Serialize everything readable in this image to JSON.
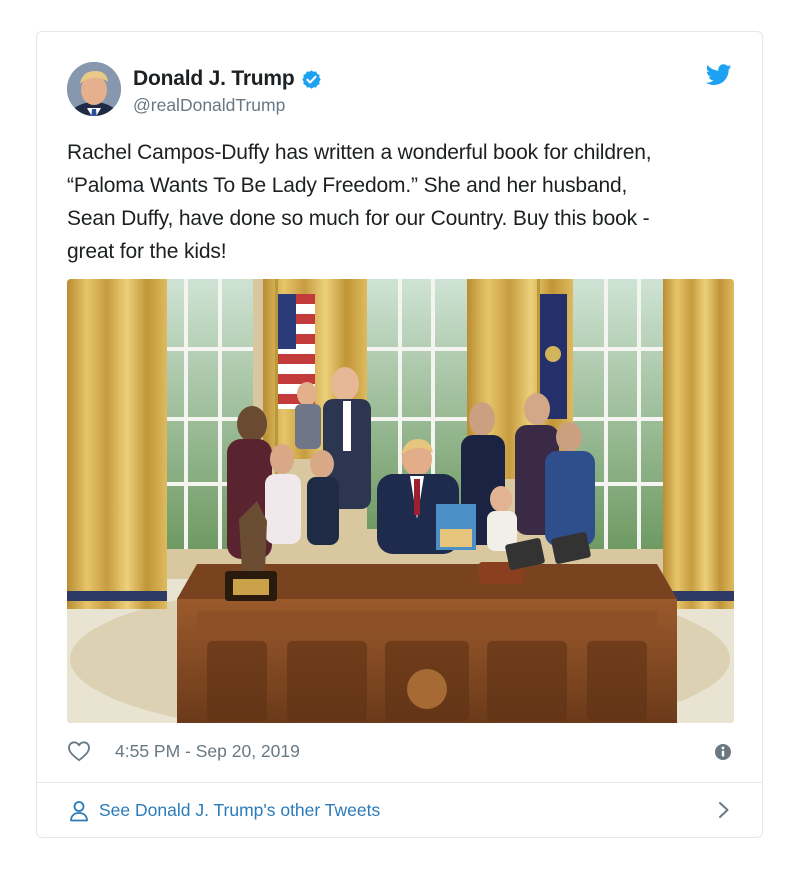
{
  "tweet": {
    "author": {
      "display_name": "Donald J. Trump",
      "handle": "@realDonaldTrump",
      "verified": true,
      "avatar_icon": "profile-photo"
    },
    "text": "Rachel Campos-Duffy has written a wonderful book for children,\n“Paloma Wants To Be Lady Freedom.” She and her husband,\nSean Duffy, have done so much for our Country. Buy this book -\ngreat for the kids!",
    "media": {
      "kind": "photo",
      "description_icon": "oval-office-group-photo"
    },
    "timestamp": "4:55 PM - Sep 20, 2019",
    "footer_link": "See Donald J. Trump's other Tweets"
  },
  "icons": {
    "brand": "twitter-bird-icon",
    "like": "heart-icon",
    "info": "info-icon",
    "user": "user-icon",
    "chevron": "chevron-right-icon"
  },
  "colors": {
    "twitter_blue": "#1da1f2",
    "link_blue": "#2b7bb9",
    "secondary_text": "#697882",
    "border": "#e1e8ed",
    "primary_text": "#1c2022"
  }
}
